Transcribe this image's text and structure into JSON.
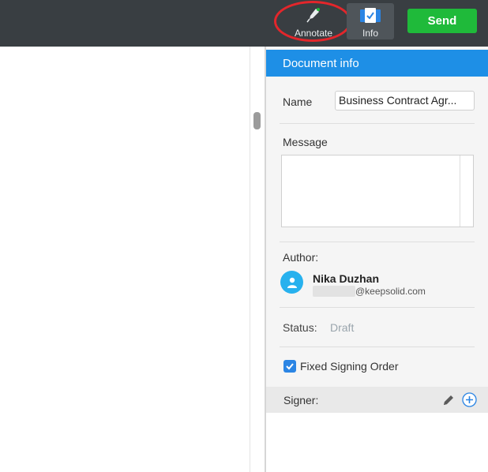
{
  "toolbar": {
    "annotate_label": "Annotate",
    "info_label": "Info",
    "send_label": "Send",
    "icons": {
      "annotate": "pen-nib-icon",
      "info": "checklist-icon"
    },
    "colors": {
      "background": "#393e42",
      "send": "#1fba3a",
      "highlight": "#e3262b"
    }
  },
  "panel": {
    "title": "Document info",
    "name_label": "Name",
    "name_value": "Business Contract  Agr...",
    "message_label": "Message",
    "message_value": "",
    "author_label": "Author:",
    "author_name": "Nika Duzhan",
    "author_email_domain": "@keepsolid.com",
    "status_label": "Status:",
    "status_value": "Draft",
    "fixed_order_label": "Fixed Signing Order",
    "fixed_order_checked": true,
    "signer_label": "Signer:",
    "colors": {
      "header": "#1e8fe6",
      "avatar": "#27b1ee",
      "status": "#9aa5ad"
    }
  }
}
